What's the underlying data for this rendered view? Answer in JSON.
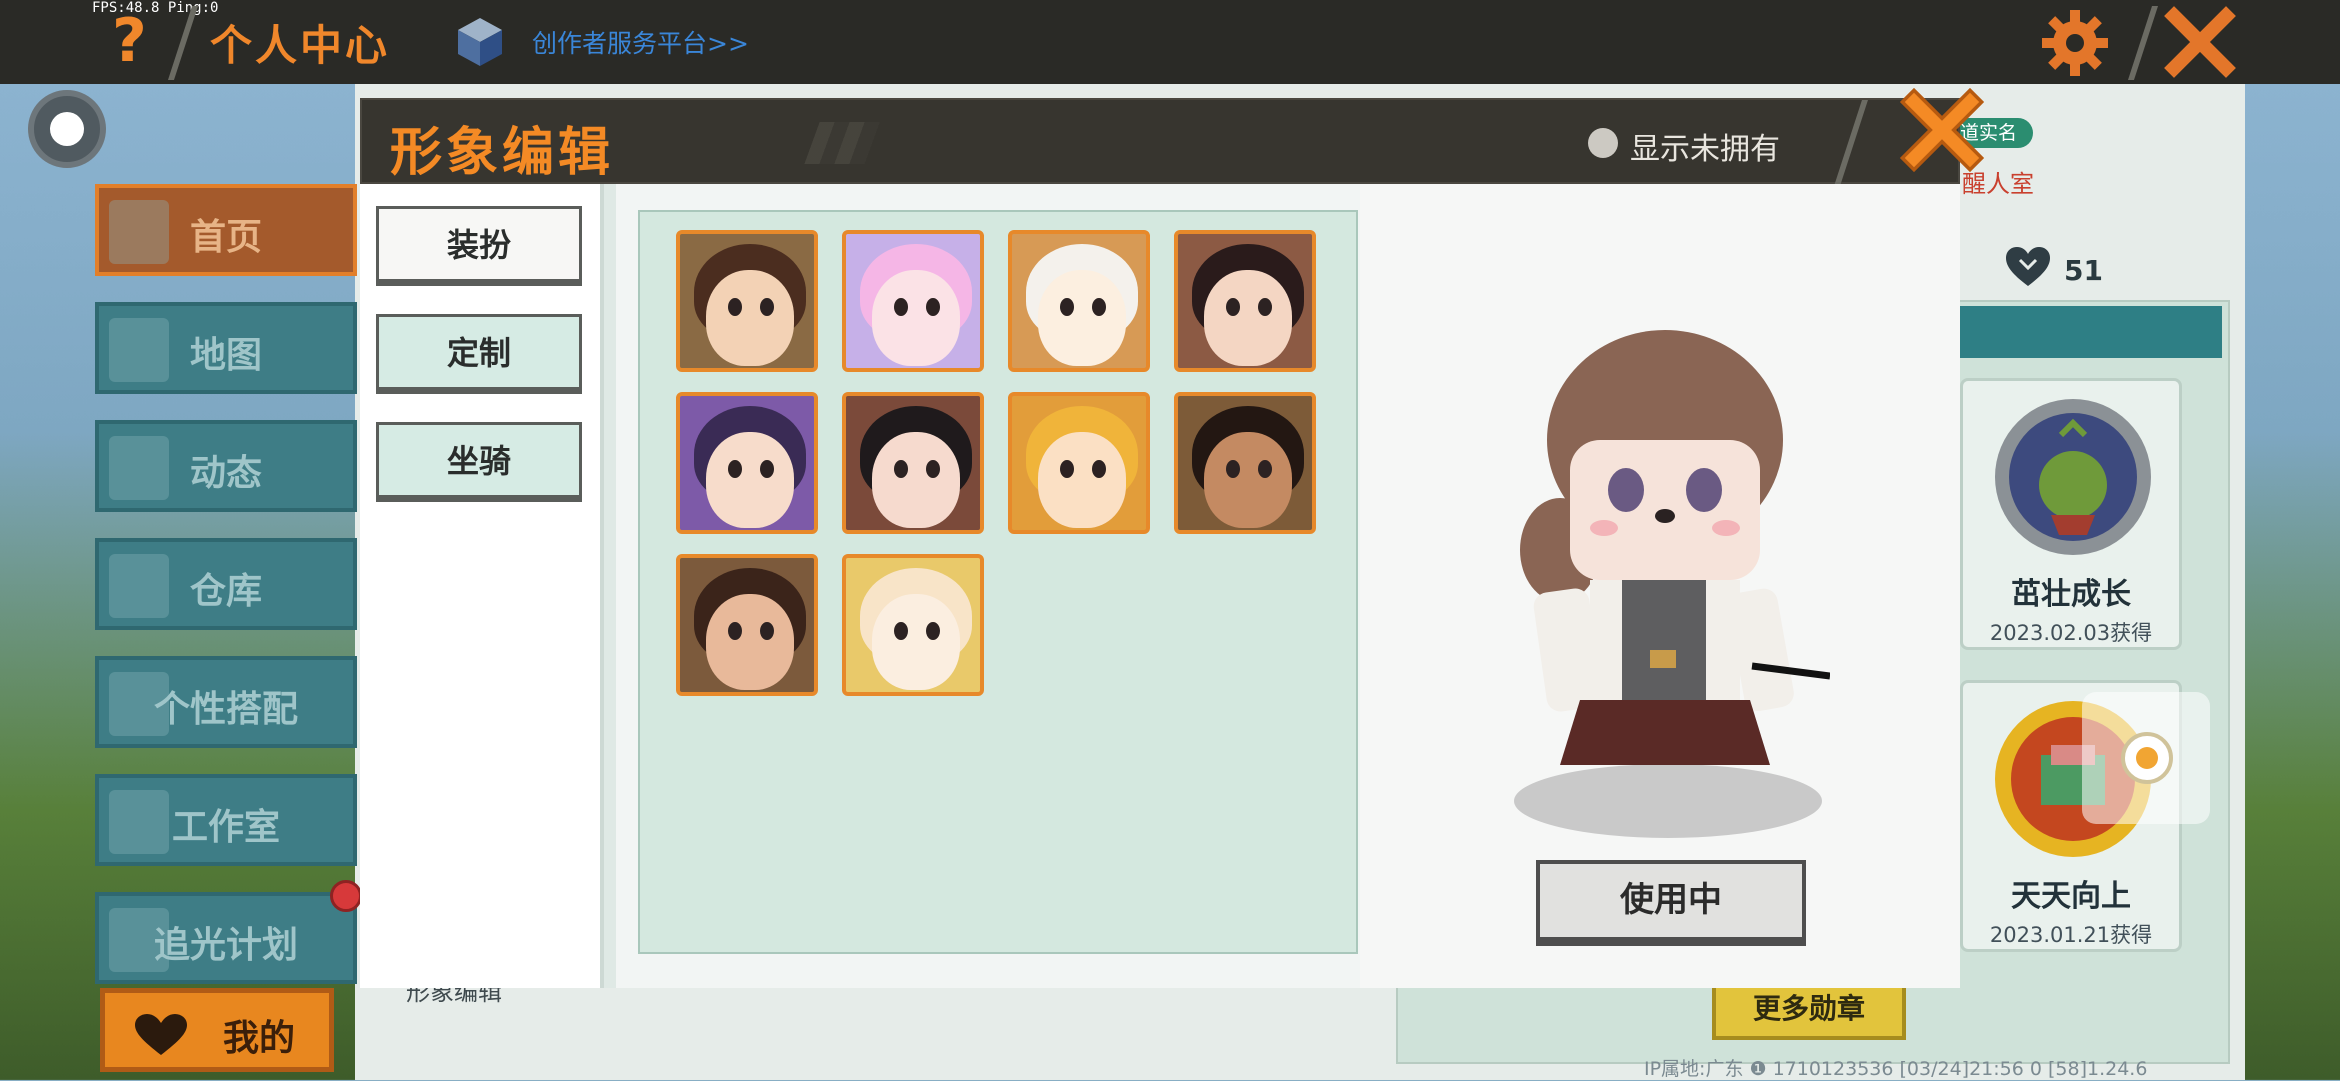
{
  "status": {
    "fps_text": "FPS:48.8  Ping:0"
  },
  "topbar": {
    "help_icon": "?",
    "title": "个人中心",
    "creator_link": "创作者服务平台>>",
    "icons": [
      "question-mark-icon",
      "creator-cube-icon",
      "gear-icon",
      "close-icon"
    ],
    "accent_color": "#f0872b"
  },
  "side_nav": {
    "items": [
      {
        "label": "首页",
        "active": true
      },
      {
        "label": "地图"
      },
      {
        "label": "动态"
      },
      {
        "label": "仓库"
      },
      {
        "label": "个性搭配"
      },
      {
        "label": "工作室"
      },
      {
        "label": "追光计划"
      }
    ],
    "my_button": "我的"
  },
  "profile_bg": {
    "realname_badge": "道实名",
    "room_label": "醒人室",
    "likes": "51",
    "badges": [
      {
        "name": "茁壮成长",
        "date": "2023.02.03获得",
        "icon": "sprout-medal-icon"
      },
      {
        "name": "天天向上",
        "date": "2023.01.21获得",
        "icon": "daily-medal-icon"
      }
    ],
    "more_badges": "更多勋章",
    "caption": "形象编辑",
    "ip_footer": "IP属地:广东 ❶    1710123536    [03/24]21:56 0    [58]1.24.6"
  },
  "dialog": {
    "title": "形象编辑",
    "show_unowned_label": "显示未拥有",
    "tabs": [
      {
        "label": "装扮",
        "selected": true
      },
      {
        "label": "定制",
        "selected": false
      },
      {
        "label": "坐骑",
        "selected": false
      }
    ],
    "skins": [
      {
        "name": "skin-1",
        "bg": "#8a6a44",
        "hair": "#4b2d1f",
        "skin": "#f3d2b5"
      },
      {
        "name": "skin-2",
        "bg": "#c6b0e8",
        "hair": "#f5b6e6",
        "skin": "#fbe2e6"
      },
      {
        "name": "skin-3",
        "bg": "#d79a55",
        "hair": "#f4f1ec",
        "skin": "#fcefe0"
      },
      {
        "name": "skin-4",
        "bg": "#8c5a44",
        "hair": "#2a1b1b",
        "skin": "#f4d6c3"
      },
      {
        "name": "skin-5",
        "bg": "#7d5aa8",
        "hair": "#3a2b55",
        "skin": "#f7dccb"
      },
      {
        "name": "skin-6",
        "bg": "#7b4a3a",
        "hair": "#1f1a1c",
        "skin": "#f6dace"
      },
      {
        "name": "skin-7",
        "bg": "#e29d3a",
        "hair": "#f0b43a",
        "skin": "#fbe0c4"
      },
      {
        "name": "skin-8",
        "bg": "#7d5b38",
        "hair": "#231712",
        "skin": "#c48a62"
      },
      {
        "name": "skin-9",
        "bg": "#7c5a3c",
        "hair": "#3b241a",
        "skin": "#e8b99a"
      },
      {
        "name": "skin-10",
        "bg": "#e9c96a",
        "hair": "#f8e4c8",
        "skin": "#fbeee0"
      }
    ],
    "use_button": "使用中"
  }
}
